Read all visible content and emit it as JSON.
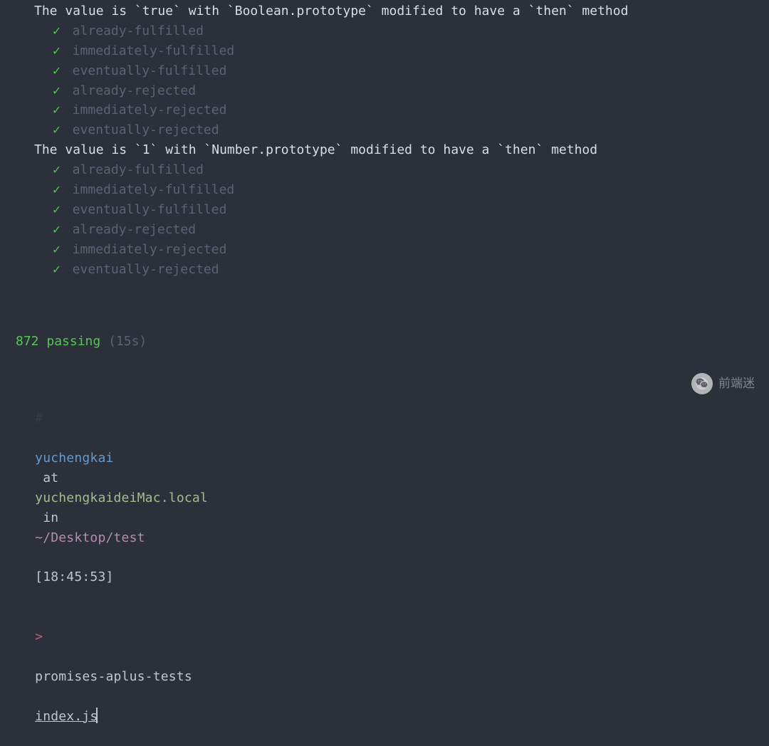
{
  "groups": [
    {
      "title": "The value is `true` with `Boolean.prototype` modified to have a `then` method",
      "tests": [
        "already-fulfilled",
        "immediately-fulfilled",
        "eventually-fulfilled",
        "already-rejected",
        "immediately-rejected",
        "eventually-rejected"
      ]
    },
    {
      "title": "The value is `1` with `Number.prototype` modified to have a `then` method",
      "tests": [
        "already-fulfilled",
        "immediately-fulfilled",
        "eventually-fulfilled",
        "already-rejected",
        "immediately-rejected",
        "eventually-rejected"
      ]
    }
  ],
  "summary": {
    "passing_count": "872",
    "passing_label": "passing",
    "duration": "(15s)"
  },
  "prompt": {
    "hash": "#",
    "user": "yuchengkai",
    "at": "at",
    "host": "yuchengkaideiMac.local",
    "in": "in",
    "path": "~/Desktop/test",
    "time": "[18:45:53]",
    "arrow": ">",
    "command": "promises-aplus-tests",
    "arg": "index.js"
  },
  "watermark": {
    "label": "前端迷"
  }
}
